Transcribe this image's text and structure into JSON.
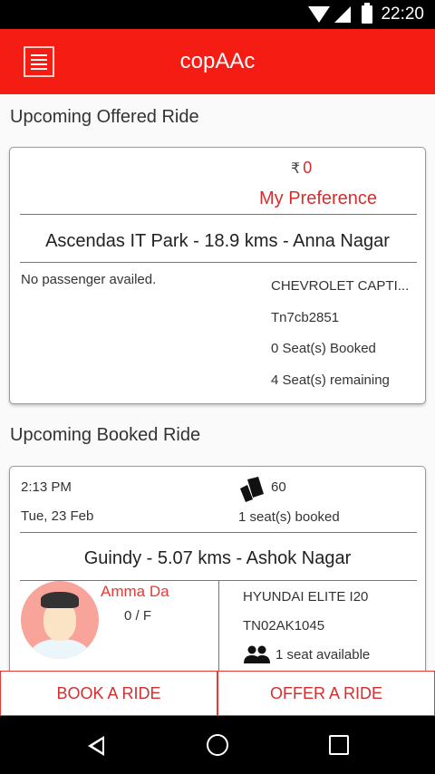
{
  "status_bar": {
    "time": "22:20"
  },
  "app_bar": {
    "title": "copAAc"
  },
  "offered": {
    "section_title": "Upcoming Offered Ride",
    "currency": "₹",
    "price": "0",
    "preference": "My Preference",
    "route": "Ascendas IT Park - 18.9 kms - Anna Nagar",
    "no_passenger": "No passenger availed.",
    "car_model": "CHEVROLET CAPTI...",
    "car_number": "Tn7cb2851",
    "seats_booked": "0 Seat(s) Booked",
    "seats_remaining": "4 Seat(s) remaining"
  },
  "booked": {
    "section_title": "Upcoming Booked Ride",
    "time": "2:13 PM",
    "date": "Tue, 23 Feb",
    "fare": "60",
    "seats_booked": "1 seat(s) booked",
    "route": "Guindy - 5.07 kms - Ashok Nagar",
    "rider_name": "Amma Da",
    "rider_rating": "0 / F",
    "car_model": "HYUNDAI ELITE I20",
    "car_number": "TN02AK1045",
    "seats_available": "1 seat available"
  },
  "buttons": {
    "book": "BOOK A RIDE",
    "offer": "OFFER A RIDE"
  },
  "colors": {
    "accent": "#f51c14",
    "text_red": "#d32f2f"
  },
  "icons": {
    "menu": "hamburger-menu-icon",
    "fare": "tickets-icon",
    "seats": "people-icon"
  }
}
